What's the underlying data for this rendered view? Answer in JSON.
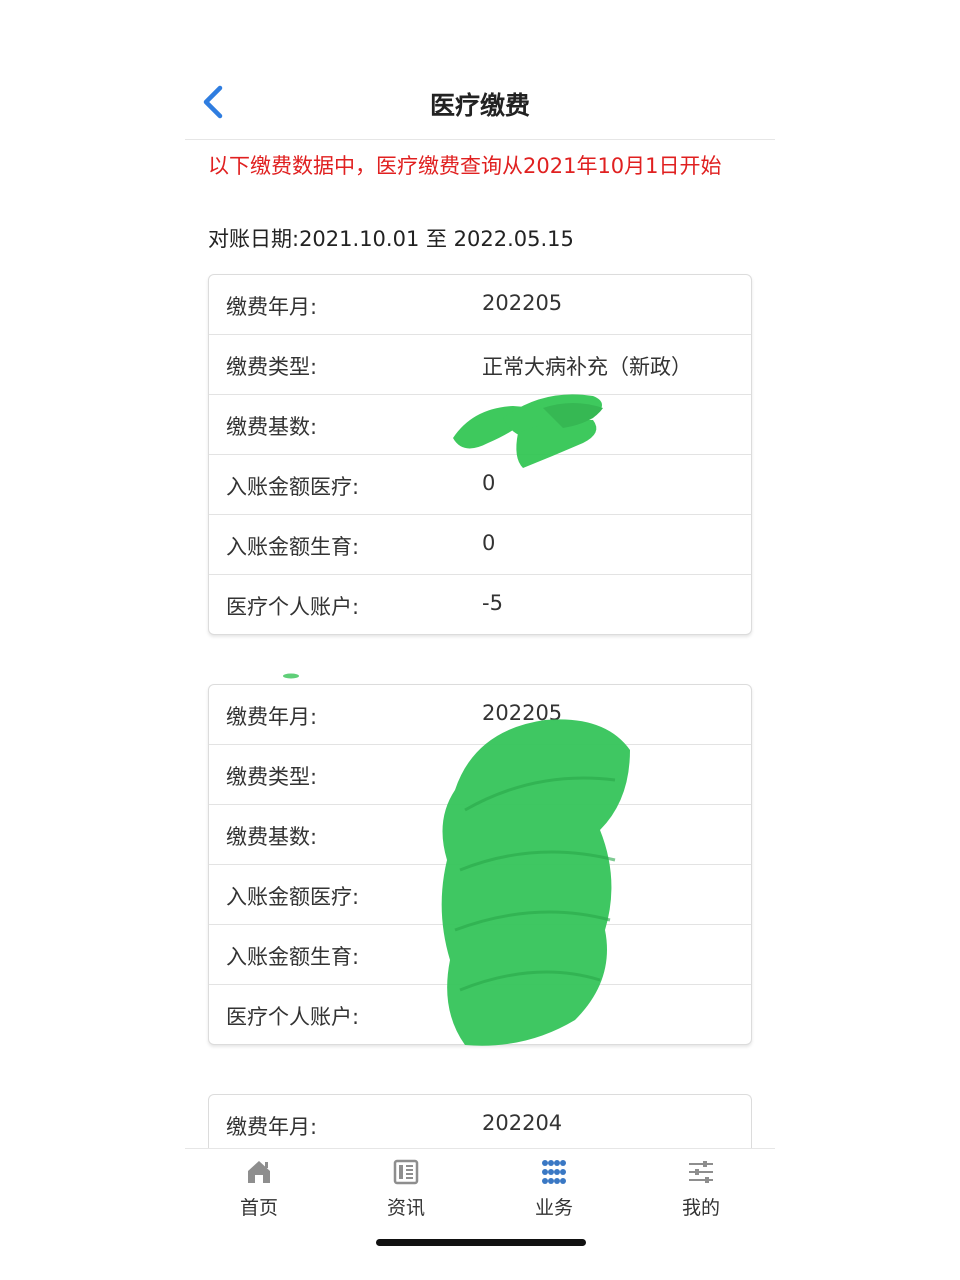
{
  "header": {
    "title": "医疗缴费",
    "back_icon": "chevron-left-icon"
  },
  "notice": {
    "text": "以下缴费数据中，医疗缴费查询从2021年10月1日开始",
    "color": "#e02020"
  },
  "date_range": {
    "text": "对账日期:2021.10.01 至 2022.05.15"
  },
  "records": [
    {
      "rows": [
        {
          "label": "缴费年月:",
          "value": "202205"
        },
        {
          "label": "缴费类型:",
          "value": "正常大病补充（新政）"
        },
        {
          "label": "缴费基数:",
          "value": ""
        },
        {
          "label": "入账金额医疗:",
          "value": "0"
        },
        {
          "label": "入账金额生育:",
          "value": "0"
        },
        {
          "label": "医疗个人账户:",
          "value": "-5"
        }
      ]
    },
    {
      "rows": [
        {
          "label": "缴费年月:",
          "value": "202205"
        },
        {
          "label": "缴费类型:",
          "value": ""
        },
        {
          "label": "缴费基数:",
          "value": ""
        },
        {
          "label": "入账金额医疗:",
          "value": ""
        },
        {
          "label": "入账金额生育:",
          "value": ""
        },
        {
          "label": "医疗个人账户:",
          "value": ""
        }
      ]
    },
    {
      "rows": [
        {
          "label": "缴费年月:",
          "value": "202204"
        }
      ]
    }
  ],
  "tabbar": {
    "active_color": "#3a78c4",
    "tabs": [
      {
        "label": "首页",
        "icon": "home-icon",
        "active": false
      },
      {
        "label": "资讯",
        "icon": "news-icon",
        "active": false
      },
      {
        "label": "业务",
        "icon": "grid-icon",
        "active": true
      },
      {
        "label": "我的",
        "icon": "settings-sliders-icon",
        "active": false
      }
    ]
  },
  "redaction_color": "#2ec550"
}
